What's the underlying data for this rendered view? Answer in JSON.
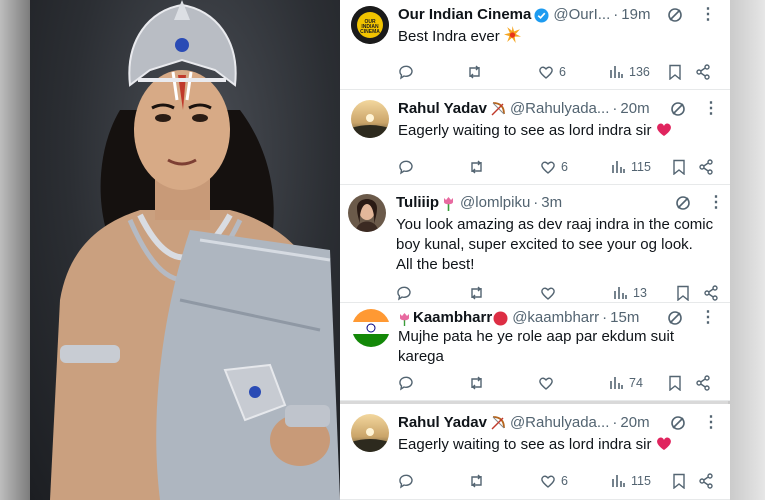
{
  "tweets": [
    {
      "name": "Our Indian Cinema",
      "handle": "@OurI...",
      "time": "19m",
      "text": "Best Indra ever",
      "likes": "6",
      "views": "136",
      "verified": true,
      "avatar_text": "OUR INDIAN CINEMA"
    },
    {
      "name": "Rahul Yadav",
      "handle": "@Rahulyada...",
      "time": "20m",
      "text": "Eagerly waiting to see as lord indra sir",
      "likes": "6",
      "views": "115"
    },
    {
      "name": "Tuliiip",
      "handle": "@lomlpiku",
      "time": "3m",
      "text_lines": [
        "You look amazing as dev raaj indra in the comic",
        "boy kunal, super excited to see your og look.",
        "All the best!"
      ],
      "views": "13"
    },
    {
      "name": "Kaambharr",
      "handle": "@kaambharr",
      "time": "15m",
      "text_lines": [
        "Mujhe pata he ye role aap par ekdum suit",
        "karega"
      ],
      "views": "74"
    },
    {
      "name": "Rahul Yadav",
      "handle": "@Rahulyada...",
      "time": "20m",
      "text": "Eagerly waiting to see as lord indra sir",
      "likes": "6",
      "views": "115"
    }
  ],
  "separator_dot": "·",
  "more_glyph": "⋮",
  "colors": {
    "verified": "#1d9bf0",
    "muted": "#536471",
    "text": "#0f1419",
    "heart": "#e0245e"
  }
}
